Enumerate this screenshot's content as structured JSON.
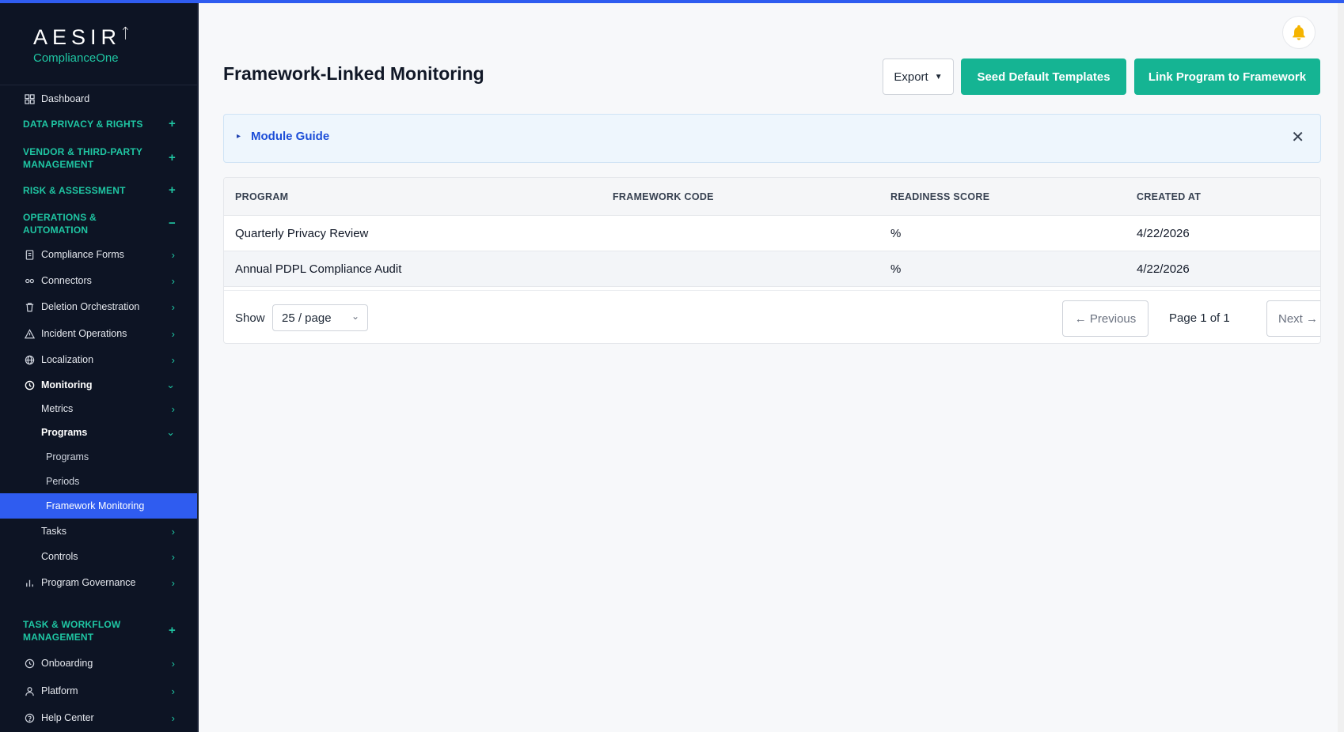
{
  "brand": {
    "name": "AESIR",
    "sub": "ComplianceOne"
  },
  "sidebar": {
    "dashboard": "Dashboard",
    "sec_privacy": "DATA PRIVACY & RIGHTS",
    "sec_vendor": "VENDOR & THIRD-PARTY MANAGEMENT",
    "sec_risk": "RISK & ASSESSMENT",
    "sec_ops": "OPERATIONS & AUTOMATION",
    "compliance_forms": "Compliance Forms",
    "connectors": "Connectors",
    "deletion": "Deletion Orchestration",
    "incident": "Incident Operations",
    "localization": "Localization",
    "monitoring": "Monitoring",
    "metrics": "Metrics",
    "programs": "Programs",
    "programs_sub": "Programs",
    "periods": "Periods",
    "framework_monitoring": "Framework Monitoring",
    "tasks": "Tasks",
    "controls": "Controls",
    "program_governance": "Program Governance",
    "sec_task": "TASK & WORKFLOW MANAGEMENT",
    "onboarding": "Onboarding",
    "platform": "Platform",
    "help_center": "Help Center",
    "plus": "+",
    "minus": "−",
    "chev_right": "›",
    "chev_down": "⌄"
  },
  "header": {
    "title": "Framework-Linked Monitoring",
    "export_label": "Export",
    "export_caret": "▼",
    "seed_label": "Seed Default Templates",
    "link_label": "Link Program to Framework"
  },
  "guide": {
    "title": "Module Guide",
    "toggle": "▸",
    "close": "✕"
  },
  "table": {
    "columns": [
      "PROGRAM",
      "FRAMEWORK CODE",
      "READINESS SCORE",
      "CREATED AT"
    ],
    "rows": [
      {
        "program": "Quarterly Privacy Review",
        "framework_code": "",
        "readiness": "%",
        "created": "4/22/2026"
      },
      {
        "program": "Annual PDPL Compliance Audit",
        "framework_code": "",
        "readiness": "%",
        "created": "4/22/2026"
      }
    ]
  },
  "pagination": {
    "show_label": "Show",
    "page_size": "25 / page",
    "caret": "⌄",
    "prev_label": "← Previous",
    "page_info": "Page 1 of 1",
    "next_label": "Next →"
  },
  "colors": {
    "accent": "#15b493",
    "active": "#2f5cf0",
    "sidebar_bg": "#0d1424",
    "section": "#1fc6a3"
  }
}
